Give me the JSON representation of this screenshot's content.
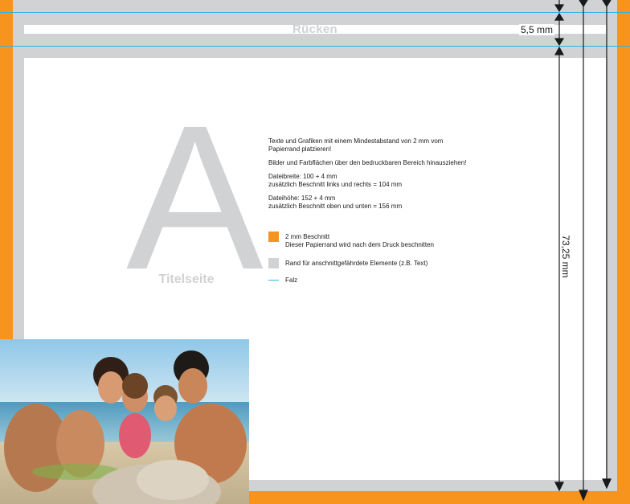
{
  "spine": {
    "label": "Rücken"
  },
  "dimensions": {
    "spine_width": "5,5 mm",
    "page_height": "73,25 mm"
  },
  "cover": {
    "letter": "A",
    "label": "Titelseite"
  },
  "instructions": {
    "line1": "Texte und Grafiken mit einem Mindestabstand von 2 mm vom",
    "line2": "Papierrand platzieren!",
    "line3": "Bilder und Farbflächen über den bedruckbaren Bereich hinausziehen!",
    "line4": "Dateibreite: 100 + 4 mm",
    "line5": "zusätzlich Beschnitt links und rechts = 104 mm",
    "line6": "Dateihöhe: 152 + 4 mm",
    "line7": "zusätzlich Beschnitt oben und unten = 156 mm"
  },
  "legend": {
    "bleed_title": "2 mm Beschnitt",
    "bleed_desc": "Dieser Papierrand wird nach dem Druck beschnitten",
    "margin_desc": "Rand für anschnittgefährdete Elemente (z.B. Text)",
    "fold_desc": "Falz"
  },
  "colors": {
    "bleed": "#f7941d",
    "safety_margin": "#d1d2d4",
    "fold": "#29b6e8"
  },
  "photo": {
    "icon": "family-beach-photo"
  }
}
